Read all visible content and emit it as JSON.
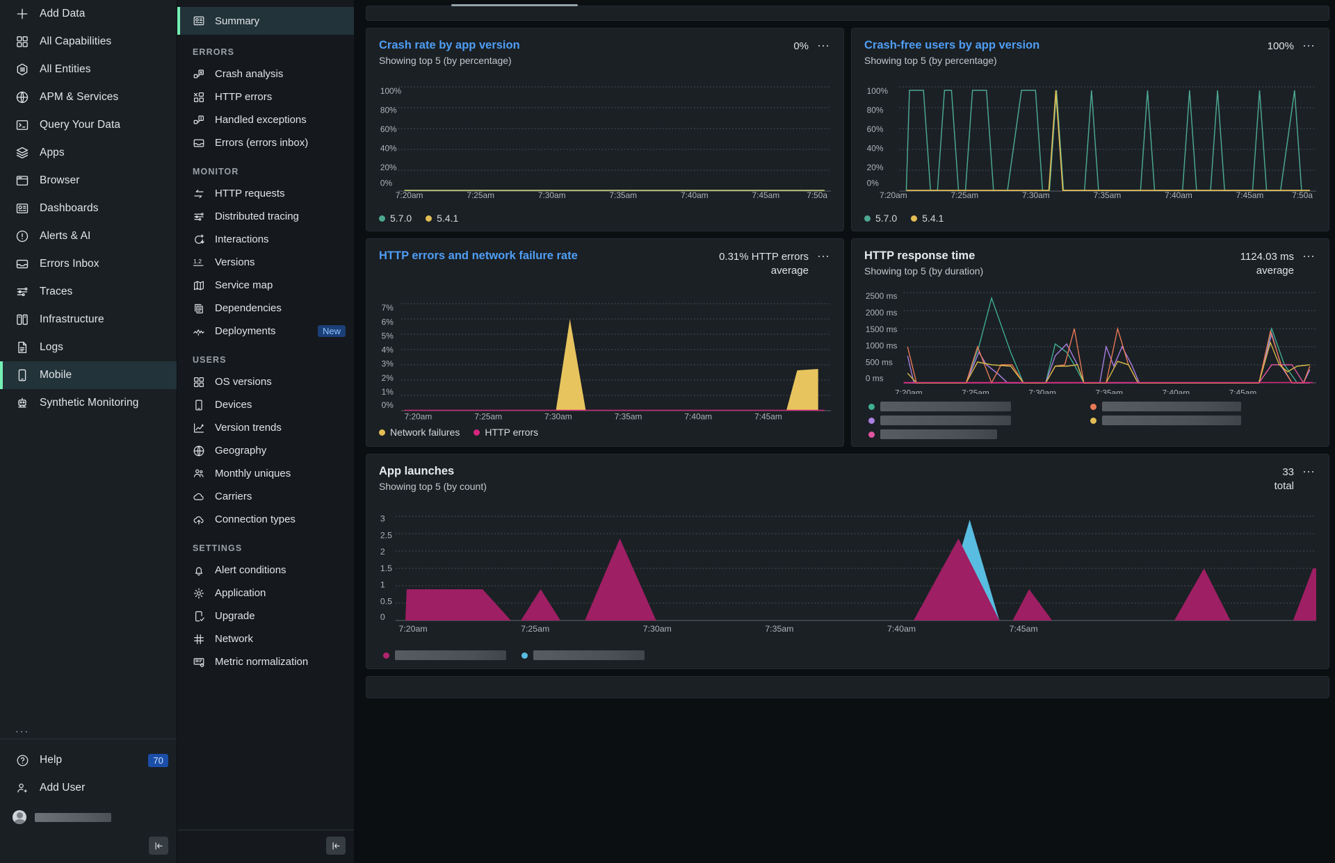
{
  "primary_nav": {
    "items": [
      {
        "label": "Add Data",
        "icon": "plus-icon",
        "active": false
      },
      {
        "label": "All Capabilities",
        "icon": "grid-icon",
        "active": false
      },
      {
        "label": "All Entities",
        "icon": "entities-icon",
        "active": false
      },
      {
        "label": "APM & Services",
        "icon": "globe-icon",
        "active": false
      },
      {
        "label": "Query Your Data",
        "icon": "terminal-icon",
        "active": false
      },
      {
        "label": "Apps",
        "icon": "layers-icon",
        "active": false
      },
      {
        "label": "Browser",
        "icon": "browser-window-icon",
        "active": false
      },
      {
        "label": "Dashboards",
        "icon": "dashboard-icon",
        "active": false
      },
      {
        "label": "Alerts & AI",
        "icon": "alert-octagon-icon",
        "active": false
      },
      {
        "label": "Errors Inbox",
        "icon": "inbox-icon",
        "active": false
      },
      {
        "label": "Traces",
        "icon": "traces-icon",
        "active": false
      },
      {
        "label": "Infrastructure",
        "icon": "servers-icon",
        "active": false
      },
      {
        "label": "Logs",
        "icon": "document-icon",
        "active": false
      },
      {
        "label": "Mobile",
        "icon": "mobile-device-icon",
        "active": true
      },
      {
        "label": "Synthetic Monitoring",
        "icon": "robot-icon",
        "active": false
      }
    ],
    "more_label": "...",
    "help_label": "Help",
    "help_count": "70",
    "add_user_label": "Add User",
    "collapse_label": "|←"
  },
  "secondary_nav": {
    "summary": {
      "label": "Summary",
      "icon": "dashboard-icon",
      "active": true
    },
    "sections": [
      {
        "title": "ERRORS",
        "items": [
          {
            "label": "Crash analysis",
            "icon": "crash-icon"
          },
          {
            "label": "HTTP errors",
            "icon": "http-errors-icon"
          },
          {
            "label": "Handled exceptions",
            "icon": "exception-icon"
          },
          {
            "label": "Errors (errors inbox)",
            "icon": "inbox-icon"
          }
        ]
      },
      {
        "title": "MONITOR",
        "items": [
          {
            "label": "HTTP requests",
            "icon": "exchange-arrows-icon"
          },
          {
            "label": "Distributed tracing",
            "icon": "traces-icon"
          },
          {
            "label": "Interactions",
            "icon": "interaction-icon"
          },
          {
            "label": "Versions",
            "icon": "version-number-icon"
          },
          {
            "label": "Service map",
            "icon": "map-icon"
          },
          {
            "label": "Dependencies",
            "icon": "dependencies-icon"
          },
          {
            "label": "Deployments",
            "icon": "deployments-icon",
            "badge": "New"
          }
        ]
      },
      {
        "title": "USERS",
        "items": [
          {
            "label": "OS versions",
            "icon": "grid-icon"
          },
          {
            "label": "Devices",
            "icon": "mobile-device-icon"
          },
          {
            "label": "Version trends",
            "icon": "line-chart-icon"
          },
          {
            "label": "Geography",
            "icon": "globe-icon"
          },
          {
            "label": "Monthly uniques",
            "icon": "users-icon"
          },
          {
            "label": "Carriers",
            "icon": "cloud-icon"
          },
          {
            "label": "Connection types",
            "icon": "cloud-upload-icon"
          }
        ]
      },
      {
        "title": "SETTINGS",
        "items": [
          {
            "label": "Alert conditions",
            "icon": "bell-icon"
          },
          {
            "label": "Application",
            "icon": "gear-icon"
          },
          {
            "label": "Upgrade",
            "icon": "upgrade-device-icon"
          },
          {
            "label": "Network",
            "icon": "network-icon"
          },
          {
            "label": "Metric normalization",
            "icon": "metric-normalization-icon"
          }
        ]
      }
    ],
    "collapse_label": "|←"
  },
  "colors": {
    "accent_green": "#74f0b5",
    "link_blue": "#4f9ef5",
    "series_green": "#4ca98f",
    "series_yellow": "#e3bd55",
    "series_magenta": "#b0246e",
    "series_pink": "#e0559f",
    "series_cyan": "#58bde0",
    "series_purple": "#a97fe0",
    "series_orange": "#e97a55",
    "series_teal": "#3fae91"
  },
  "cards": [
    {
      "id": "crash-rate",
      "title": "Crash rate by app version",
      "title_is_link": true,
      "subtitle": "Showing top 5 (by percentage)",
      "metric": "0%",
      "kebab": "⋯"
    },
    {
      "id": "crash-free-users",
      "title": "Crash-free users by app version",
      "title_is_link": true,
      "subtitle": "Showing top 5 (by percentage)",
      "metric": "100%",
      "kebab": "⋯"
    },
    {
      "id": "http-errors",
      "title": "HTTP errors and network failure rate",
      "title_is_link": true,
      "subtitle": "",
      "metric": "0.31%  HTTP errors\naverage",
      "kebab": "⋯"
    },
    {
      "id": "http-response-time",
      "title": "HTTP response time",
      "title_is_link": false,
      "subtitle": "Showing top 5 (by duration)",
      "metric": "1124.03 ms\naverage",
      "kebab": "⋯"
    },
    {
      "id": "app-launches",
      "title": "App launches",
      "title_is_link": false,
      "subtitle": "Showing top 5 (by count)",
      "metric": "33\ntotal",
      "kebab": "⋯"
    }
  ],
  "chart_data": [
    {
      "id": "crash-rate",
      "type": "line",
      "title": "Crash rate by app version",
      "subtitle": "Showing top 5 (by percentage)",
      "headline_value": "0%",
      "xlabel": "",
      "ylabel": "",
      "ylim": [
        0,
        100
      ],
      "yticks": [
        "0%",
        "20%",
        "40%",
        "60%",
        "80%",
        "100%"
      ],
      "xticks": [
        "7:20am",
        "7:25am",
        "7:30am",
        "7:35am",
        "7:40am",
        "7:45am",
        "7:50a"
      ],
      "grid": true,
      "legend_position": "bottom",
      "legend": [
        {
          "name": "5.7.0",
          "color": "#4ca98f"
        },
        {
          "name": "5.4.1",
          "color": "#e3bd55"
        }
      ],
      "series": [
        {
          "name": "5.7.0",
          "color": "#4ca98f",
          "values": [
            0,
            0,
            0,
            0,
            0,
            0,
            0,
            0,
            0,
            0,
            0,
            0,
            0,
            0,
            0,
            0,
            0,
            0,
            0,
            0,
            0,
            0,
            0,
            0,
            0,
            0,
            0,
            0,
            0,
            0,
            0
          ]
        },
        {
          "name": "5.4.1",
          "color": "#e3bd55",
          "values": [
            0,
            0,
            0,
            0,
            0,
            0,
            0,
            0,
            0,
            0,
            0,
            0,
            0,
            0,
            0,
            0,
            0,
            0,
            0,
            0,
            0,
            0,
            0,
            0,
            0,
            0,
            0,
            0,
            0,
            0,
            0
          ]
        }
      ]
    },
    {
      "id": "crash-free-users",
      "type": "line",
      "title": "Crash-free users by app version",
      "subtitle": "Showing top 5 (by percentage)",
      "headline_value": "100%",
      "ylim": [
        0,
        100
      ],
      "yticks": [
        "0%",
        "20%",
        "40%",
        "60%",
        "80%",
        "100%"
      ],
      "xticks": [
        "7:20am",
        "7:25am",
        "7:30am",
        "7:35am",
        "7:40am",
        "7:45am",
        "7:50a"
      ],
      "grid": true,
      "legend_position": "bottom",
      "legend": [
        {
          "name": "5.7.0",
          "color": "#4ca98f"
        },
        {
          "name": "5.4.1",
          "color": "#e3bd55"
        }
      ],
      "series": [
        {
          "name": "5.7.0",
          "color": "#4ca98f",
          "values": [
            0,
            95,
            95,
            0,
            0,
            95,
            0,
            95,
            95,
            0,
            0,
            0,
            95,
            95,
            0,
            95,
            0,
            0,
            95,
            0,
            0,
            0,
            0,
            0,
            95,
            0,
            95,
            0,
            0,
            95,
            0
          ]
        },
        {
          "name": "5.4.1",
          "color": "#e3bd55",
          "values": [
            0,
            0,
            0,
            0,
            0,
            0,
            0,
            0,
            0,
            0,
            0,
            0,
            0,
            95,
            0,
            0,
            0,
            0,
            0,
            0,
            0,
            0,
            0,
            0,
            0,
            0,
            0,
            0,
            0,
            0,
            0
          ]
        }
      ]
    },
    {
      "id": "http-errors",
      "type": "area",
      "title": "HTTP errors and network failure rate",
      "headline_value": "0.31%",
      "headline_label": "HTTP errors average",
      "ylim": [
        0,
        7
      ],
      "yticks": [
        "0%",
        "1%",
        "2%",
        "3%",
        "4%",
        "5%",
        "6%",
        "7%"
      ],
      "xticks": [
        "7:20am",
        "7:25am",
        "7:30am",
        "7:35am",
        "7:40am",
        "7:45am"
      ],
      "grid": true,
      "legend_position": "bottom",
      "legend": [
        {
          "name": "Network failures",
          "color": "#e3bd55"
        },
        {
          "name": "HTTP errors",
          "color": "#d6267e"
        }
      ],
      "series": [
        {
          "name": "Network failures",
          "color": "#e3bd55",
          "values": [
            0,
            0,
            0,
            0,
            0,
            0,
            0,
            0,
            0,
            0,
            0,
            0,
            0,
            6.0,
            0,
            0,
            0,
            0,
            0,
            0,
            0,
            0,
            0,
            0,
            0,
            0,
            0,
            2.75,
            2.8,
            0,
            0
          ]
        },
        {
          "name": "HTTP errors",
          "color": "#d6267e",
          "values": [
            0,
            0,
            0,
            0,
            0,
            0,
            0,
            0,
            0,
            0,
            0,
            0,
            0,
            0,
            0,
            0,
            0,
            0,
            0,
            0,
            0,
            0,
            0,
            0,
            0,
            0,
            0,
            0,
            0,
            0,
            0
          ]
        }
      ]
    },
    {
      "id": "http-response-time",
      "type": "line",
      "title": "HTTP response time",
      "subtitle": "Showing top 5 (by duration)",
      "headline_value": "1124.03 ms",
      "headline_label": "average",
      "ylim": [
        0,
        2500
      ],
      "yticks": [
        "0 ms",
        "500 ms",
        "1000 ms",
        "1500 ms",
        "2000 ms",
        "2500 ms"
      ],
      "xticks": [
        "7:20am",
        "7:25am",
        "7:30am",
        "7:35am",
        "7:40am",
        "7:45am"
      ],
      "grid": true,
      "legend_position": "bottom",
      "legend": [
        {
          "name": "",
          "color": "#3fae91",
          "redacted": true
        },
        {
          "name": "",
          "color": "#a97fe0",
          "redacted": true
        },
        {
          "name": "",
          "color": "#e0559f",
          "redacted": true
        },
        {
          "name": "",
          "color": "#e97a55",
          "redacted": true
        },
        {
          "name": "",
          "color": "#e3bd55",
          "redacted": true
        }
      ],
      "series": [
        {
          "name": "series-1",
          "color": "#3fae91",
          "values": [
            0,
            0,
            0,
            0,
            0,
            0,
            2150,
            700,
            0,
            0,
            0,
            0,
            950,
            800,
            0,
            0,
            0,
            600,
            900,
            0,
            0,
            0,
            0,
            0,
            0,
            1050,
            500,
            450,
            0,
            0,
            0
          ]
        },
        {
          "name": "series-2",
          "color": "#a97fe0",
          "values": [
            750,
            0,
            0,
            0,
            0,
            900,
            500,
            300,
            0,
            0,
            0,
            0,
            650,
            800,
            0,
            1000,
            300,
            0,
            200,
            900,
            0,
            0,
            0,
            0,
            0,
            1000,
            450,
            450,
            0,
            350,
            650
          ]
        },
        {
          "name": "series-3",
          "color": "#e0559f",
          "values": [
            0,
            0,
            0,
            0,
            0,
            0,
            0,
            0,
            0,
            0,
            0,
            0,
            0,
            0,
            0,
            0,
            0,
            0,
            0,
            0,
            0,
            0,
            0,
            0,
            0,
            0,
            0,
            450,
            450,
            0,
            0
          ]
        },
        {
          "name": "series-4",
          "color": "#e97a55",
          "values": [
            1000,
            0,
            0,
            0,
            0,
            1000,
            0,
            500,
            450,
            0,
            0,
            0,
            450,
            440,
            0,
            1500,
            0,
            0,
            1480,
            0,
            0,
            0,
            0,
            0,
            0,
            1450,
            850,
            0,
            0,
            0,
            700
          ]
        },
        {
          "name": "series-5",
          "color": "#e3bd55",
          "values": [
            180,
            0,
            0,
            0,
            0,
            570,
            500,
            480,
            0,
            0,
            0,
            0,
            440,
            430,
            0,
            600,
            0,
            0,
            600,
            0,
            0,
            0,
            0,
            0,
            0,
            1150,
            700,
            550,
            480,
            0,
            750
          ]
        }
      ]
    },
    {
      "id": "app-launches",
      "type": "area",
      "title": "App launches",
      "subtitle": "Showing top 5 (by count)",
      "headline_value": "33",
      "headline_label": "total",
      "ylim": [
        0,
        3
      ],
      "yticks": [
        "0",
        "0.5",
        "1",
        "1.5",
        "2",
        "2.5",
        "3"
      ],
      "xticks": [
        "7:20am",
        "7:25am",
        "7:30am",
        "7:35am",
        "7:40am",
        "7:45am"
      ],
      "grid": true,
      "legend_position": "bottom",
      "legend": [
        {
          "name": "",
          "color": "#b0246e",
          "redacted": true
        },
        {
          "name": "",
          "color": "#58bde0",
          "redacted": true
        }
      ],
      "series": [
        {
          "name": "series-magenta",
          "color": "#b0246e",
          "values": [
            0,
            0.9,
            0.9,
            0.9,
            0,
            0.9,
            0,
            1.85,
            0.9,
            0,
            0,
            0,
            1.85,
            0,
            0.9,
            0.75,
            0,
            0,
            0,
            0,
            0,
            0,
            0,
            0,
            1.85,
            0,
            1.85,
            0,
            0,
            0,
            0
          ]
        },
        {
          "name": "series-cyan",
          "color": "#58bde0",
          "values": [
            0,
            0,
            0,
            0,
            0,
            0,
            0,
            0,
            0,
            0,
            0,
            0,
            2.8,
            0,
            0,
            0,
            0,
            0,
            0,
            0,
            0,
            0,
            0,
            0,
            0,
            0,
            0,
            0,
            0,
            0,
            0
          ]
        }
      ]
    }
  ]
}
